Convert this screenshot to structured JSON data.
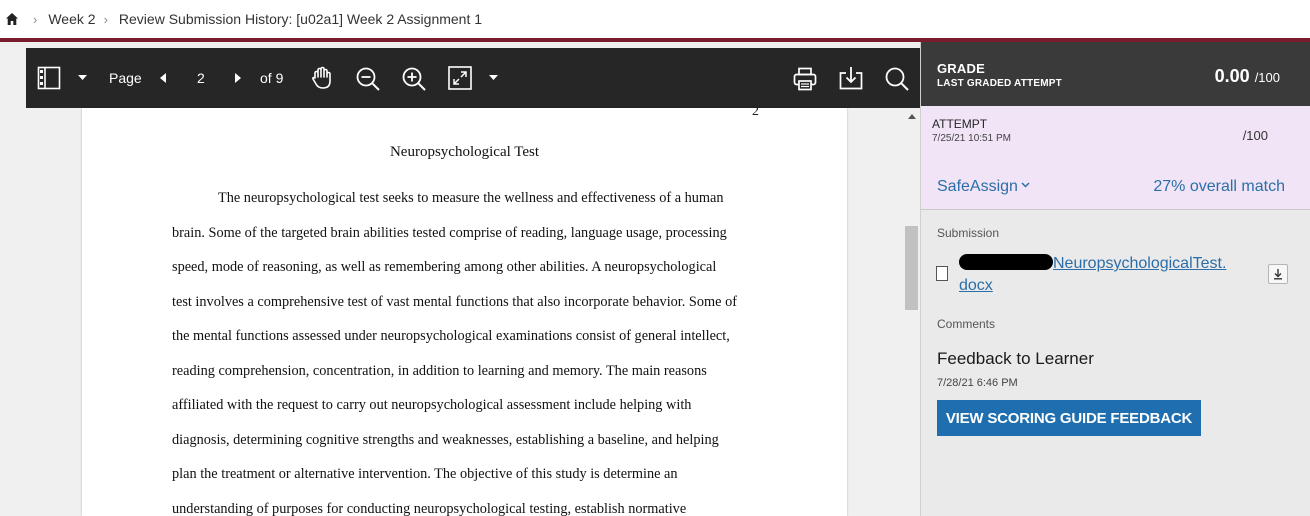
{
  "breadcrumb": {
    "home_icon": "home-icon",
    "items": [
      "Week 2",
      "Review Submission History: [u02a1] Week 2 Assignment 1"
    ]
  },
  "toolbar": {
    "page_label": "Page",
    "page_current": "2",
    "page_total": "of 9"
  },
  "document": {
    "page_number": "2",
    "title": "Neuropsychological Test",
    "lines": [
      "The neuropsychological test seeks to measure the wellness and effectiveness of a human",
      "brain. Some of the targeted brain abilities tested comprise of reading, language usage, processing",
      "speed, mode of reasoning, as well as remembering among other abilities. A neuropsychological",
      "test involves a comprehensive test of vast mental functions that also incorporate behavior. Some of",
      "the mental functions assessed under neuropsychological examinations consist of general intellect,",
      "reading comprehension, concentration, in addition to learning and memory. The main reasons",
      "affiliated with the request to carry out neuropsychological assessment include helping with",
      "diagnosis, determining cognitive strengths and weaknesses, establishing a baseline, and helping",
      "plan the treatment or alternative intervention. The objective of this study is determine an",
      "understanding of purposes for conducting neuropsychological testing, establish normative"
    ]
  },
  "grade": {
    "label": "GRADE",
    "sublabel": "LAST GRADED ATTEMPT",
    "value": "0.00",
    "out_of": "/100"
  },
  "attempt": {
    "label": "ATTEMPT",
    "date": "7/25/21 10:51 PM",
    "score": "/100",
    "safeassign": "SafeAssign",
    "match": "27% overall match"
  },
  "submission": {
    "label": "Submission",
    "file_line1": "NeuropsychologicalTest.",
    "file_line2": "docx"
  },
  "comments": {
    "label": "Comments",
    "title": "Feedback to Learner",
    "date": "7/28/21 6:46 PM",
    "button": "VIEW SCORING GUIDE FEEDBACK"
  },
  "colors": {
    "accent_bar": "#7a1b2b",
    "toolbar": "#262626",
    "attempt_bg": "#f0e4f6",
    "link": "#2c6ea8",
    "button": "#1f6fb0"
  }
}
